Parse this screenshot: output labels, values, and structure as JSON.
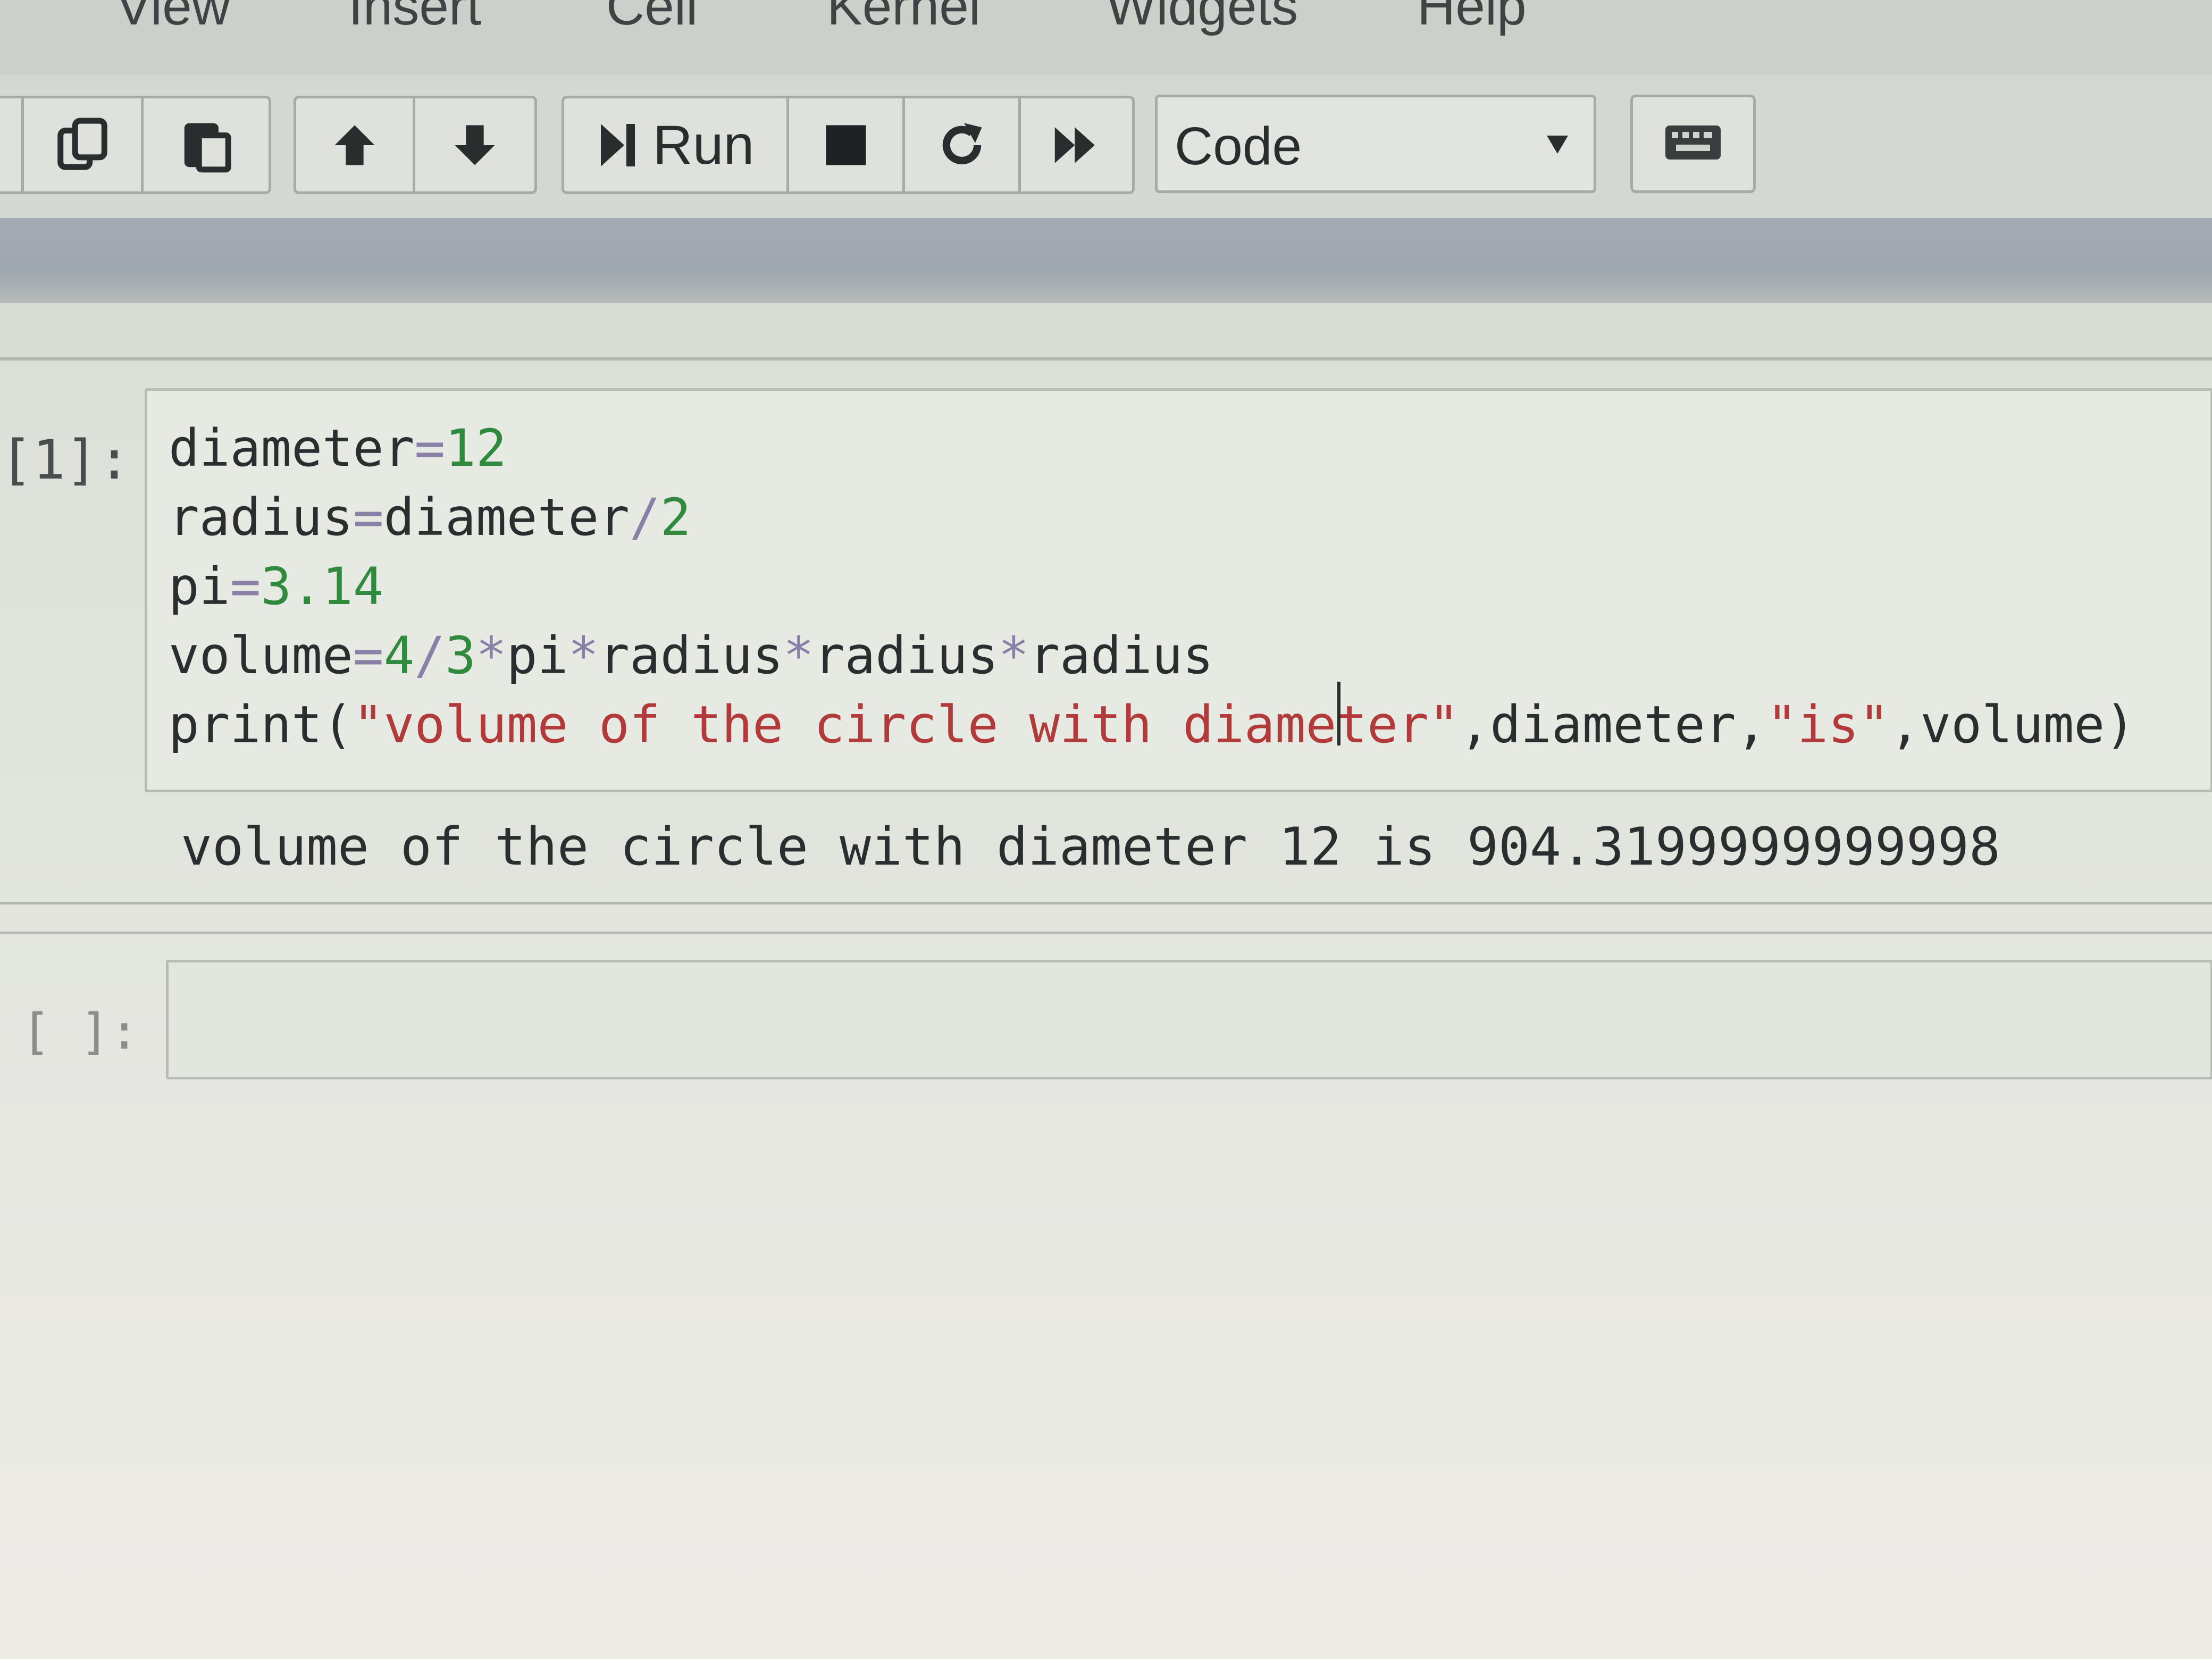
{
  "menu": {
    "items": [
      "View",
      "Insert",
      "Cell",
      "Kernel",
      "Widgets",
      "Help"
    ]
  },
  "toolbar": {
    "run_label": "Run",
    "cell_type": "Code"
  },
  "cells": [
    {
      "prompt": "[1]:",
      "code_lines": [
        {
          "segments": [
            {
              "t": "diameter",
              "c": ""
            },
            {
              "t": "=",
              "c": "op"
            },
            {
              "t": "12",
              "c": "num"
            }
          ]
        },
        {
          "segments": [
            {
              "t": "radius",
              "c": ""
            },
            {
              "t": "=",
              "c": "op"
            },
            {
              "t": "diameter",
              "c": ""
            },
            {
              "t": "/",
              "c": "op"
            },
            {
              "t": "2",
              "c": "num"
            }
          ]
        },
        {
          "segments": [
            {
              "t": "pi",
              "c": ""
            },
            {
              "t": "=",
              "c": "op"
            },
            {
              "t": "3.14",
              "c": "num"
            }
          ]
        },
        {
          "segments": [
            {
              "t": "volume",
              "c": ""
            },
            {
              "t": "=",
              "c": "op"
            },
            {
              "t": "4",
              "c": "num"
            },
            {
              "t": "/",
              "c": "op"
            },
            {
              "t": "3",
              "c": "num"
            },
            {
              "t": "*",
              "c": "op"
            },
            {
              "t": "pi",
              "c": ""
            },
            {
              "t": "*",
              "c": "op"
            },
            {
              "t": "radius",
              "c": ""
            },
            {
              "t": "*",
              "c": "op"
            },
            {
              "t": "radius",
              "c": ""
            },
            {
              "t": "*",
              "c": "op"
            },
            {
              "t": "radius",
              "c": ""
            }
          ]
        },
        {
          "segments": [
            {
              "t": "print(",
              "c": ""
            },
            {
              "t": "\"volume of the circle with diameter\"",
              "c": "str"
            },
            {
              "t": ",diameter,",
              "c": ""
            },
            {
              "t": "\"is\"",
              "c": "str"
            },
            {
              "t": ",volume)",
              "c": ""
            }
          ]
        }
      ],
      "output": "volume of the circle with diameter 12 is 904.3199999999998"
    },
    {
      "prompt": "[ ]:",
      "code_lines": [],
      "output": ""
    }
  ],
  "icons": {
    "copy": "copy-icon",
    "paste": "paste-icon",
    "move_up": "arrow-up-icon",
    "move_down": "arrow-down-icon",
    "run": "step-forward-icon",
    "stop": "stop-icon",
    "restart": "restart-icon",
    "fast_forward": "fast-forward-icon",
    "dropdown": "caret-down-icon",
    "keyboard": "keyboard-icon"
  },
  "colors": {
    "string": "#b23a3a",
    "operator": "#8a7fa7",
    "number": "#2f8a3e",
    "text": "#2b2e2f"
  }
}
